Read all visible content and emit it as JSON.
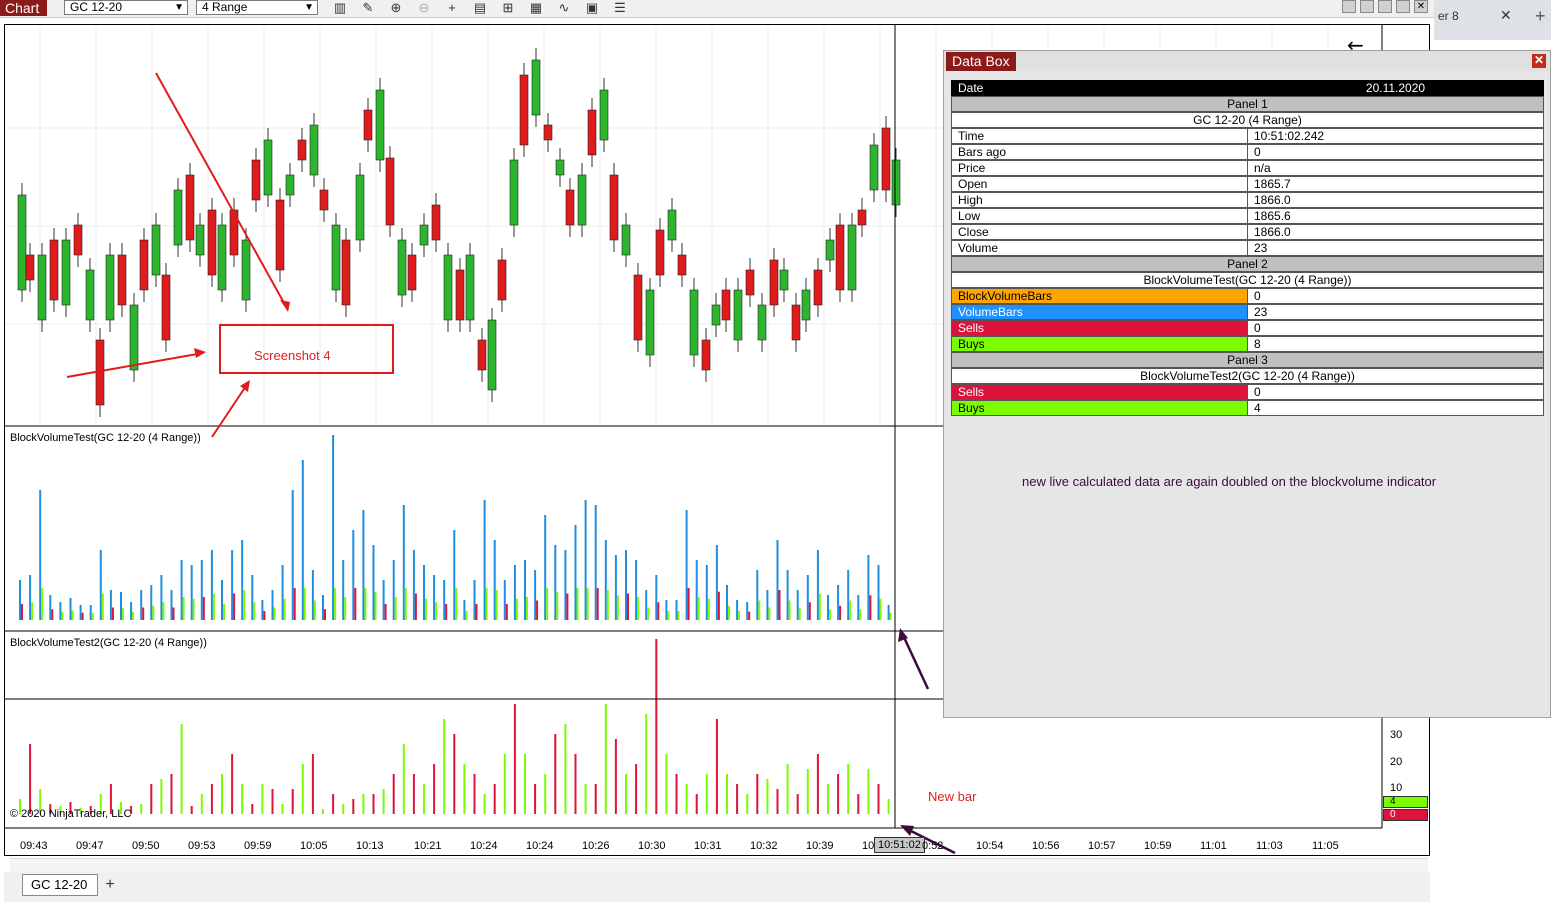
{
  "toolbar": {
    "chart_tab": "Chart",
    "instrument": "GC 12-20",
    "interval": "4 Range"
  },
  "browser": {
    "tab_fragment": "er 8",
    "close": "✕",
    "new_tab": "+"
  },
  "chart": {
    "panel2_label": "BlockVolumeTest(GC 12-20 (4 Range))",
    "panel3_label": "BlockVolumeTest2(GC 12-20 (4 Range))",
    "copyright": "© 2020 NinjaTrader, LLC",
    "time_labels": [
      "09:43",
      "09:47",
      "09:50",
      "09:53",
      "09:59",
      "10:05",
      "10:13",
      "10:21",
      "10:24",
      "10:24",
      "10:26",
      "10:30",
      "10:31",
      "10:32",
      "10:39",
      "10",
      "10:51:02",
      "0:52",
      "10:54",
      "10:56",
      "10:57",
      "10:59",
      "11:01",
      "11:03",
      "11:05"
    ],
    "y_axis_labels": [
      "30",
      "20",
      "10"
    ],
    "price_badges": [
      "4",
      "0"
    ]
  },
  "databox": {
    "title": "Data Box",
    "date_key": "Date",
    "date_value": "20.11.2020",
    "panel1": "Panel 1",
    "panel1_sub": "GC 12-20 (4 Range)",
    "panel1_rows": [
      {
        "k": "Time",
        "v": "10:51:02.242"
      },
      {
        "k": "Bars ago",
        "v": "0"
      },
      {
        "k": "Price",
        "v": "n/a"
      },
      {
        "k": "Open",
        "v": "1865.7"
      },
      {
        "k": "High",
        "v": "1866.0"
      },
      {
        "k": "Low",
        "v": "1865.6"
      },
      {
        "k": "Close",
        "v": "1866.0"
      },
      {
        "k": "Volume",
        "v": "23"
      }
    ],
    "panel2": "Panel 2",
    "panel2_sub": "BlockVolumeTest(GC 12-20 (4 Range))",
    "panel2_rows": [
      {
        "k": "BlockVolumeBars",
        "v": "0",
        "color": "#ffa500"
      },
      {
        "k": "VolumeBars",
        "v": "23",
        "color": "#1e90ff"
      },
      {
        "k": "Sells",
        "v": "0",
        "color": "#dc143c"
      },
      {
        "k": "Buys",
        "v": "8",
        "color": "#7cfc00"
      }
    ],
    "panel3": "Panel 3",
    "panel3_sub": "BlockVolumeTest2(GC 12-20 (4 Range))",
    "panel3_rows": [
      {
        "k": "Sells",
        "v": "0",
        "color": "#dc143c"
      },
      {
        "k": "Buys",
        "v": "4",
        "color": "#7cfc00"
      }
    ]
  },
  "annotations": {
    "screenshot_label": "Screenshot 4",
    "note": "new live calculated data are again doubled on the blockvolume indicator",
    "new_bar": "New bar"
  },
  "bottom": {
    "tab": "GC 12-20",
    "add": "+"
  },
  "colors": {
    "up": "#2db52d",
    "down": "#e01b1b",
    "blue": "#1e8fe0",
    "green": "#7cfc00",
    "crimson": "#dc143c",
    "brand": "#8b1b1b"
  }
}
